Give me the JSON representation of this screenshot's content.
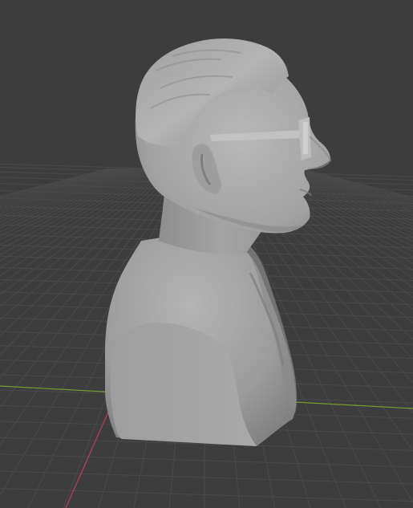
{
  "viewport": {
    "mode": "3d-viewport",
    "shading": "solid",
    "colors": {
      "background": "#3d3d3d",
      "grid": "#4a4a4a",
      "x_axis": "#7a9d32",
      "y_axis": "#b54155",
      "mesh": "#a8a8a8"
    }
  },
  "object": {
    "type": "sculpted-bust",
    "subject": "man-with-glasses",
    "view": "side-profile"
  }
}
